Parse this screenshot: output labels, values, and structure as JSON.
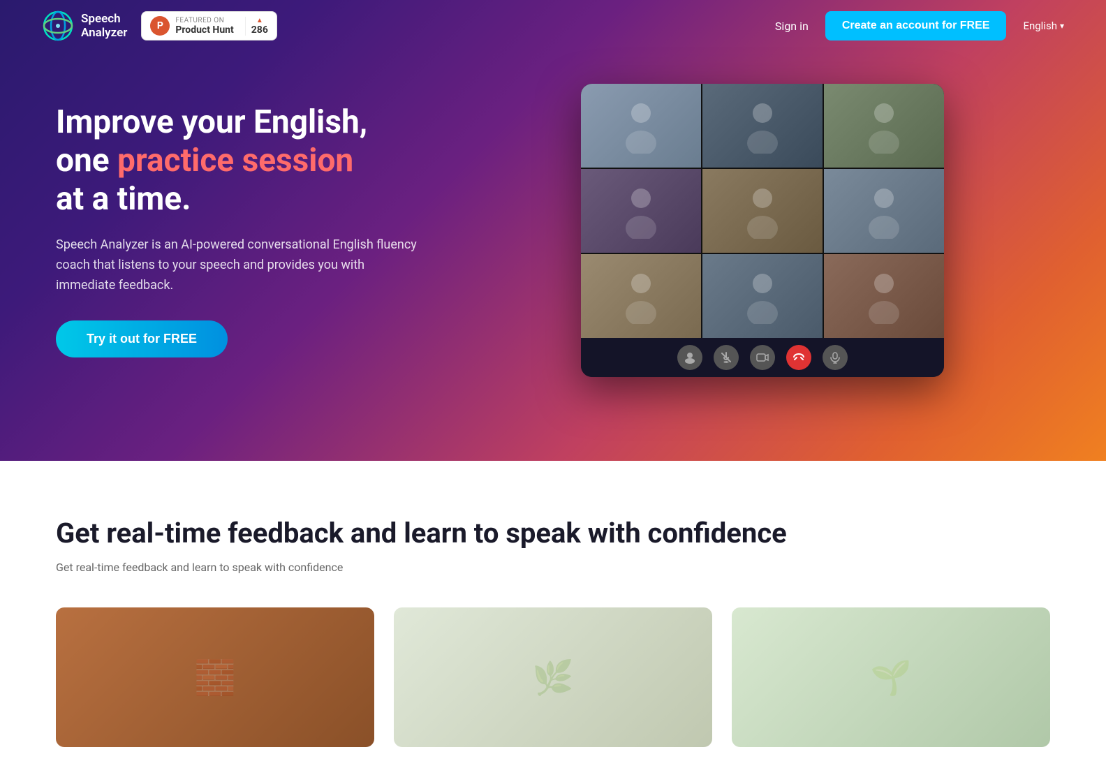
{
  "brand": {
    "name": "Speech Analyzer",
    "logo_line1": "Speech",
    "logo_line2": "Analyzer"
  },
  "producthunt": {
    "featured_label": "FEATURED ON",
    "name": "Product Hunt",
    "votes": "286"
  },
  "nav": {
    "signin_label": "Sign in",
    "cta_label": "Create an account for FREE",
    "lang_label": "English"
  },
  "hero": {
    "title_part1": "Improve your English,",
    "title_part2": "one ",
    "title_highlight": "practice session",
    "title_part3": " at a time.",
    "description": "Speech Analyzer is an AI-powered conversational English fluency coach that listens to your speech and provides you with immediate feedback.",
    "cta_label": "Try it out for FREE"
  },
  "video_grid": {
    "persons": [
      "👤",
      "👤",
      "👤",
      "👤",
      "👤",
      "👤",
      "👤",
      "👤",
      "👤"
    ]
  },
  "controls": {
    "profile_icon": "👤",
    "mute_icon": "🔇",
    "camera_icon": "📷",
    "end_icon": "📵",
    "mic_icon": "🎤"
  },
  "section2": {
    "title": "Get real-time feedback and learn to speak with confidence",
    "subtitle": "Get real-time feedback and learn to speak with confidence"
  }
}
